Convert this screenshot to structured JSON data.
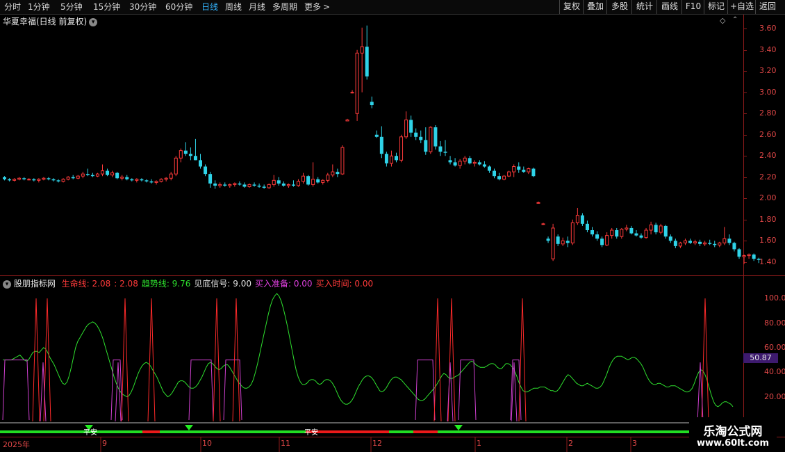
{
  "toolbar": {
    "periods": [
      "分时",
      "1分钟",
      "5分钟",
      "15分钟",
      "30分钟",
      "60分钟",
      "日线",
      "周线",
      "月线",
      "多周期",
      "更多"
    ],
    "active_period": "日线",
    "more_arrow": ">",
    "right_buttons": [
      "复权",
      "叠加",
      "多股",
      "统计",
      "画线",
      "F10",
      "标记",
      "+自选",
      "返回"
    ]
  },
  "main_chart": {
    "title": "华夏幸福(日线 前复权)",
    "dropdown_icon": "chevron-down-icon",
    "y_ticks": [
      "3.60",
      "3.40",
      "3.20",
      "3.00",
      "2.80",
      "2.60",
      "2.40",
      "2.20",
      "2.00",
      "1.80",
      "1.60",
      "1.40"
    ],
    "candles": [
      [
        2.2,
        2.21,
        2.17,
        2.18
      ],
      [
        2.18,
        2.19,
        2.16,
        2.17
      ],
      [
        2.17,
        2.19,
        2.16,
        2.18
      ],
      [
        2.18,
        2.2,
        2.17,
        2.19
      ],
      [
        2.19,
        2.2,
        2.17,
        2.18
      ],
      [
        2.18,
        2.19,
        2.17,
        2.18
      ],
      [
        2.18,
        2.19,
        2.16,
        2.17
      ],
      [
        2.17,
        2.19,
        2.15,
        2.18
      ],
      [
        2.18,
        2.2,
        2.17,
        2.19
      ],
      [
        2.19,
        2.2,
        2.17,
        2.18
      ],
      [
        2.18,
        2.19,
        2.16,
        2.17
      ],
      [
        2.17,
        2.18,
        2.15,
        2.16
      ],
      [
        2.16,
        2.19,
        2.15,
        2.18
      ],
      [
        2.18,
        2.21,
        2.17,
        2.2
      ],
      [
        2.2,
        2.22,
        2.18,
        2.19
      ],
      [
        2.19,
        2.22,
        2.18,
        2.21
      ],
      [
        2.21,
        2.25,
        2.19,
        2.23
      ],
      [
        2.23,
        2.28,
        2.21,
        2.22
      ],
      [
        2.22,
        2.24,
        2.2,
        2.21
      ],
      [
        2.21,
        2.24,
        2.2,
        2.23
      ],
      [
        2.23,
        2.32,
        2.21,
        2.26
      ],
      [
        2.26,
        2.28,
        2.21,
        2.22
      ],
      [
        2.22,
        2.26,
        2.2,
        2.24
      ],
      [
        2.24,
        2.25,
        2.18,
        2.19
      ],
      [
        2.19,
        2.22,
        2.17,
        2.2
      ],
      [
        2.2,
        2.22,
        2.17,
        2.18
      ],
      [
        2.18,
        2.19,
        2.16,
        2.17
      ],
      [
        2.17,
        2.19,
        2.15,
        2.18
      ],
      [
        2.18,
        2.19,
        2.16,
        2.17
      ],
      [
        2.17,
        2.18,
        2.15,
        2.16
      ],
      [
        2.16,
        2.18,
        2.14,
        2.15
      ],
      [
        2.15,
        2.17,
        2.13,
        2.16
      ],
      [
        2.16,
        2.19,
        2.15,
        2.18
      ],
      [
        2.18,
        2.2,
        2.16,
        2.19
      ],
      [
        2.19,
        2.25,
        2.17,
        2.23
      ],
      [
        2.23,
        2.4,
        2.21,
        2.38
      ],
      [
        2.38,
        2.47,
        2.34,
        2.45
      ],
      [
        2.45,
        2.53,
        2.4,
        2.42
      ],
      [
        2.42,
        2.48,
        2.36,
        2.4
      ],
      [
        2.4,
        2.56,
        2.36,
        2.36
      ],
      [
        2.36,
        2.42,
        2.28,
        2.3
      ],
      [
        2.3,
        2.32,
        2.21,
        2.23
      ],
      [
        2.23,
        2.25,
        2.1,
        2.14
      ],
      [
        2.14,
        2.17,
        2.09,
        2.12
      ],
      [
        2.12,
        2.15,
        2.1,
        2.13
      ],
      [
        2.13,
        2.15,
        2.11,
        2.12
      ],
      [
        2.12,
        2.14,
        2.1,
        2.13
      ],
      [
        2.13,
        2.15,
        2.11,
        2.14
      ],
      [
        2.14,
        2.16,
        2.12,
        2.13
      ],
      [
        2.13,
        2.15,
        2.1,
        2.11
      ],
      [
        2.11,
        2.14,
        2.1,
        2.13
      ],
      [
        2.13,
        2.15,
        2.11,
        2.12
      ],
      [
        2.12,
        2.14,
        2.1,
        2.11
      ],
      [
        2.11,
        2.13,
        2.09,
        2.1
      ],
      [
        2.1,
        2.14,
        2.09,
        2.13
      ],
      [
        2.13,
        2.22,
        2.11,
        2.17
      ],
      [
        2.17,
        2.2,
        2.12,
        2.14
      ],
      [
        2.14,
        2.16,
        2.11,
        2.12
      ],
      [
        2.12,
        2.14,
        2.1,
        2.13
      ],
      [
        2.13,
        2.17,
        2.11,
        2.12
      ],
      [
        2.12,
        2.18,
        2.11,
        2.16
      ],
      [
        2.16,
        2.24,
        2.14,
        2.21
      ],
      [
        2.21,
        2.22,
        2.12,
        2.13
      ],
      [
        2.13,
        2.34,
        2.11,
        2.18
      ],
      [
        2.18,
        2.2,
        2.14,
        2.15
      ],
      [
        2.15,
        2.18,
        2.13,
        2.17
      ],
      [
        2.17,
        2.24,
        2.15,
        2.22
      ],
      [
        2.22,
        2.32,
        2.2,
        2.25
      ],
      [
        2.25,
        2.28,
        2.2,
        2.23
      ],
      [
        2.23,
        2.5,
        2.22,
        2.48
      ],
      [
        2.73,
        2.75,
        2.73,
        2.74
      ],
      [
        3.0,
        3.02,
        2.99,
        3.0
      ],
      [
        2.8,
        3.4,
        2.73,
        3.37
      ],
      [
        3.37,
        3.61,
        3.0,
        3.43
      ],
      [
        3.43,
        3.63,
        3.12,
        3.15
      ],
      [
        2.91,
        2.96,
        2.85,
        2.88
      ],
      [
        2.6,
        2.64,
        2.57,
        2.58
      ],
      [
        2.58,
        2.68,
        2.38,
        2.42
      ],
      [
        2.42,
        2.44,
        2.3,
        2.33
      ],
      [
        2.33,
        2.45,
        2.3,
        2.4
      ],
      [
        2.4,
        2.43,
        2.34,
        2.36
      ],
      [
        2.36,
        2.6,
        2.34,
        2.58
      ],
      [
        2.58,
        2.82,
        2.56,
        2.74
      ],
      [
        2.74,
        2.78,
        2.58,
        2.62
      ],
      [
        2.62,
        2.66,
        2.55,
        2.58
      ],
      [
        2.58,
        2.64,
        2.52,
        2.55
      ],
      [
        2.55,
        2.67,
        2.41,
        2.44
      ],
      [
        2.44,
        2.68,
        2.42,
        2.67
      ],
      [
        2.67,
        2.69,
        2.46,
        2.49
      ],
      [
        2.49,
        2.54,
        2.4,
        2.44
      ],
      [
        2.44,
        2.55,
        2.4,
        2.43
      ],
      [
        2.36,
        2.4,
        2.32,
        2.34
      ],
      [
        2.34,
        2.38,
        2.3,
        2.31
      ],
      [
        2.31,
        2.37,
        2.28,
        2.35
      ],
      [
        2.35,
        2.4,
        2.32,
        2.38
      ],
      [
        2.38,
        2.4,
        2.32,
        2.33
      ],
      [
        2.33,
        2.36,
        2.3,
        2.34
      ],
      [
        2.34,
        2.36,
        2.31,
        2.32
      ],
      [
        2.32,
        2.35,
        2.29,
        2.3
      ],
      [
        2.3,
        2.31,
        2.24,
        2.26
      ],
      [
        2.26,
        2.28,
        2.19,
        2.21
      ],
      [
        2.21,
        2.24,
        2.17,
        2.18
      ],
      [
        2.18,
        2.22,
        2.17,
        2.21
      ],
      [
        2.21,
        2.26,
        2.2,
        2.25
      ],
      [
        2.25,
        2.32,
        2.2,
        2.3
      ],
      [
        2.3,
        2.34,
        2.24,
        2.27
      ],
      [
        2.27,
        2.3,
        2.24,
        2.25
      ],
      [
        2.25,
        2.29,
        2.23,
        2.28
      ],
      [
        2.28,
        2.29,
        2.2,
        2.21
      ],
      [
        1.96,
        1.97,
        1.95,
        1.96
      ],
      [
        1.76,
        1.77,
        1.75,
        1.76
      ],
      [
        1.62,
        1.64,
        1.58,
        1.6
      ],
      [
        1.43,
        1.76,
        1.41,
        1.72
      ],
      [
        1.64,
        1.66,
        1.55,
        1.57
      ],
      [
        1.57,
        1.63,
        1.55,
        1.6
      ],
      [
        1.6,
        1.64,
        1.54,
        1.58
      ],
      [
        1.58,
        1.8,
        1.56,
        1.77
      ],
      [
        1.77,
        1.91,
        1.75,
        1.84
      ],
      [
        1.84,
        1.86,
        1.74,
        1.76
      ],
      [
        1.76,
        1.79,
        1.68,
        1.7
      ],
      [
        1.7,
        1.73,
        1.64,
        1.66
      ],
      [
        1.66,
        1.69,
        1.6,
        1.62
      ],
      [
        1.62,
        1.64,
        1.54,
        1.56
      ],
      [
        1.56,
        1.68,
        1.55,
        1.65
      ],
      [
        1.65,
        1.72,
        1.62,
        1.7
      ],
      [
        1.7,
        1.72,
        1.62,
        1.64
      ],
      [
        1.64,
        1.72,
        1.62,
        1.71
      ],
      [
        1.71,
        1.75,
        1.69,
        1.72
      ],
      [
        1.72,
        1.74,
        1.66,
        1.67
      ],
      [
        1.67,
        1.7,
        1.64,
        1.65
      ],
      [
        1.65,
        1.67,
        1.62,
        1.63
      ],
      [
        1.63,
        1.72,
        1.62,
        1.7
      ],
      [
        1.7,
        1.78,
        1.66,
        1.75
      ],
      [
        1.75,
        1.77,
        1.66,
        1.68
      ],
      [
        1.68,
        1.76,
        1.66,
        1.74
      ],
      [
        1.74,
        1.75,
        1.62,
        1.64
      ],
      [
        1.64,
        1.66,
        1.58,
        1.6
      ],
      [
        1.6,
        1.62,
        1.53,
        1.55
      ],
      [
        1.55,
        1.59,
        1.53,
        1.58
      ],
      [
        1.58,
        1.62,
        1.56,
        1.6
      ],
      [
        1.6,
        1.62,
        1.57,
        1.58
      ],
      [
        1.58,
        1.61,
        1.56,
        1.59
      ],
      [
        1.59,
        1.61,
        1.55,
        1.57
      ],
      [
        1.57,
        1.6,
        1.55,
        1.58
      ],
      [
        1.58,
        1.61,
        1.56,
        1.57
      ],
      [
        1.57,
        1.6,
        1.54,
        1.56
      ],
      [
        1.56,
        1.59,
        1.54,
        1.58
      ],
      [
        1.58,
        1.73,
        1.56,
        1.62
      ],
      [
        1.62,
        1.66,
        1.56,
        1.58
      ],
      [
        1.58,
        1.59,
        1.5,
        1.52
      ],
      [
        1.52,
        1.53,
        1.43,
        1.45
      ],
      [
        1.45,
        1.47,
        1.38,
        1.46
      ],
      [
        1.46,
        1.48,
        1.43,
        1.47
      ],
      [
        1.47,
        1.48,
        1.41,
        1.43
      ],
      [
        1.43,
        1.44,
        1.39,
        1.42
      ]
    ]
  },
  "indicator": {
    "collapse_icon": "chevron-down-icon",
    "name": "股朋指标网",
    "items": [
      {
        "label": "生命线:",
        "value": "2.08",
        "color": "#ff3a3a"
      },
      {
        "label": ":",
        "value": "2.08",
        "color": "#ff3a3a"
      },
      {
        "label": "趋势线:",
        "value": "9.76",
        "color": "#2ee02e"
      },
      {
        "label": "见底信号:",
        "value": "9.00",
        "color": "#e0e0e0"
      },
      {
        "label": "买入准备:",
        "value": "0.00",
        "color": "#e040e0"
      },
      {
        "label": "买入时间:",
        "value": "0.00",
        "color": "#ff3a3a"
      }
    ],
    "y_ticks": [
      "100.0",
      "80.00",
      "60.00",
      "40.00",
      "20.00"
    ],
    "current_value": "50.87",
    "bottom_text": "平安",
    "trend_line": [
      50,
      50,
      50,
      50,
      50,
      51,
      52,
      53,
      54,
      52,
      50,
      49,
      50,
      53,
      56,
      57,
      57,
      56,
      58,
      60,
      59,
      56,
      52,
      49,
      46,
      42,
      38,
      34,
      31,
      30,
      32,
      37,
      44,
      52,
      60,
      65,
      68,
      71,
      74,
      77,
      79,
      80,
      81,
      80,
      78,
      75,
      71,
      66,
      60,
      54,
      48,
      42,
      36,
      31,
      27,
      24,
      22,
      21,
      20,
      21,
      24,
      28,
      33,
      38,
      42,
      45,
      47,
      48,
      47,
      45,
      42,
      39,
      36,
      32,
      28,
      24,
      22,
      20,
      21,
      23,
      26,
      29,
      32,
      33,
      33,
      32,
      30,
      28,
      27,
      27,
      28,
      30,
      33,
      36,
      40,
      44,
      47,
      48,
      47,
      45,
      43,
      42,
      43,
      45,
      46,
      46,
      44,
      41,
      38,
      35,
      32,
      30,
      28,
      27,
      27,
      28,
      30,
      34,
      40,
      47,
      55,
      63,
      71,
      79,
      87,
      94,
      99,
      102,
      104,
      102,
      98,
      92,
      85,
      77,
      68,
      59,
      50,
      42,
      36,
      32,
      30,
      30,
      31,
      33,
      34,
      34,
      33,
      31,
      30,
      31,
      33,
      34,
      34,
      33,
      31,
      28,
      24,
      20,
      17,
      15,
      14,
      14,
      15,
      17,
      20,
      24,
      28,
      31,
      34,
      36,
      37,
      37,
      36,
      34,
      31,
      28,
      25,
      24,
      25,
      27,
      30,
      33,
      35,
      36,
      36,
      35,
      34,
      32,
      30,
      28,
      26,
      24,
      22,
      20,
      18,
      17,
      17,
      18,
      20,
      22,
      24,
      26,
      28,
      31,
      34,
      37,
      39,
      38,
      36,
      35,
      35,
      36,
      37,
      38,
      40,
      42,
      44,
      46,
      48,
      49,
      48,
      46,
      45,
      44,
      44,
      44,
      45,
      46,
      47,
      47,
      46,
      44,
      43,
      43,
      45,
      47,
      47,
      46,
      44,
      41,
      37,
      32,
      28,
      25,
      24,
      24,
      25,
      26,
      27,
      27,
      27,
      28,
      28,
      28,
      27,
      26,
      25,
      25,
      24,
      25,
      27,
      30,
      33,
      36,
      38,
      37,
      35,
      33,
      31,
      30,
      29,
      29,
      30,
      31,
      30,
      29,
      28,
      27,
      27,
      28,
      30,
      34,
      38,
      43,
      47,
      50,
      52,
      53,
      53,
      53,
      52,
      51,
      50,
      51,
      52,
      52,
      51,
      49,
      47,
      44,
      40,
      36,
      33,
      31,
      30,
      30,
      31,
      31,
      30,
      29,
      28,
      28,
      29,
      29,
      29,
      28,
      27,
      26,
      25,
      24,
      24,
      25,
      27,
      31,
      36,
      40,
      42,
      41,
      38,
      33,
      27,
      21,
      16,
      13,
      12,
      13,
      15,
      16,
      16,
      15,
      14,
      12
    ]
  }
}
